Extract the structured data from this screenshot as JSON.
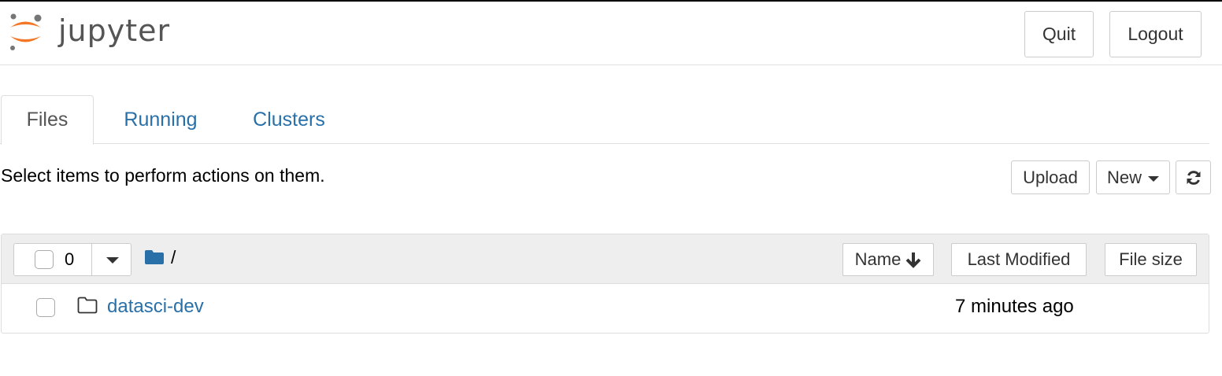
{
  "header": {
    "logo_text": "jupyter",
    "quit_label": "Quit",
    "logout_label": "Logout"
  },
  "tabs": [
    {
      "label": "Files",
      "active": true
    },
    {
      "label": "Running",
      "active": false
    },
    {
      "label": "Clusters",
      "active": false
    }
  ],
  "toolbar": {
    "hint": "Select items to perform actions on them.",
    "upload_label": "Upload",
    "new_label": "New",
    "refresh_icon": "refresh-icon"
  },
  "list": {
    "selected_count": "0",
    "path": "/",
    "sort_name_label": "Name",
    "sort_modified_label": "Last Modified",
    "sort_size_label": "File size",
    "items": [
      {
        "name": "datasci-dev",
        "type": "folder",
        "modified": "7 minutes ago",
        "size": ""
      }
    ]
  },
  "colors": {
    "link": "#2a70a8",
    "logo_orange": "#f37726",
    "logo_gray": "#767677",
    "folder_blue": "#2a70a8",
    "header_bg": "#eeeeee"
  }
}
